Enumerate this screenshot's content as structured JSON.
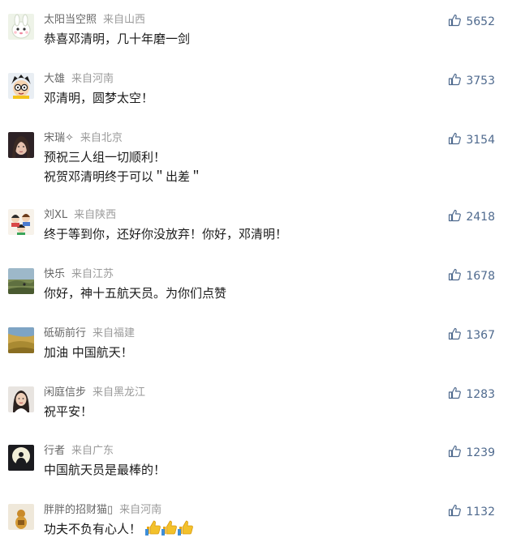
{
  "comments": [
    {
      "user": "太阳当空照",
      "location": "来自山西",
      "text": "恭喜邓清明，几十年磨一剑",
      "likes": "5652",
      "avatar": "cartoon-rabbit"
    },
    {
      "user": "大雄",
      "location": "来自河南",
      "text": "邓清明，圆梦太空！",
      "likes": "3753",
      "avatar": "cartoon-boy"
    },
    {
      "user": "宋瑞✧",
      "location": "来自北京",
      "text": "预祝三人组一切顺利！",
      "text2": "祝贺邓清明终于可以＂出差＂",
      "likes": "3154",
      "avatar": "portrait"
    },
    {
      "user": "刘XL",
      "location": "来自陕西",
      "text": "终于等到你，还好你没放弃！你好，邓清明！",
      "likes": "2418",
      "avatar": "cartoon-group"
    },
    {
      "user": "快乐",
      "location": "来自江苏",
      "text": "你好，神十五航天员。为你们点赞",
      "likes": "1678",
      "avatar": "landscape"
    },
    {
      "user": "砥砺前行",
      "location": "来自福建",
      "text": "加油 中国航天！",
      "likes": "1367",
      "avatar": "grassland"
    },
    {
      "user": "闲庭信步",
      "location": "来自黑龙江",
      "text": "祝平安！",
      "likes": "1283",
      "avatar": "woman"
    },
    {
      "user": "行者",
      "location": "来自广东",
      "text": "中国航天员是最棒的！",
      "likes": "1239",
      "avatar": "moon-silhouette"
    },
    {
      "user": "胖胖的招财猫▯",
      "location": "来自河南",
      "text": "功夫不负有心人！",
      "likes": "1132",
      "avatar": "lucky-cat",
      "emoji": "thumbs-up-icon ×3"
    }
  ],
  "colors": {
    "user": "#666666",
    "location": "#9a9a9a",
    "like": "#4f6a8e",
    "text": "#1a1a1a"
  }
}
